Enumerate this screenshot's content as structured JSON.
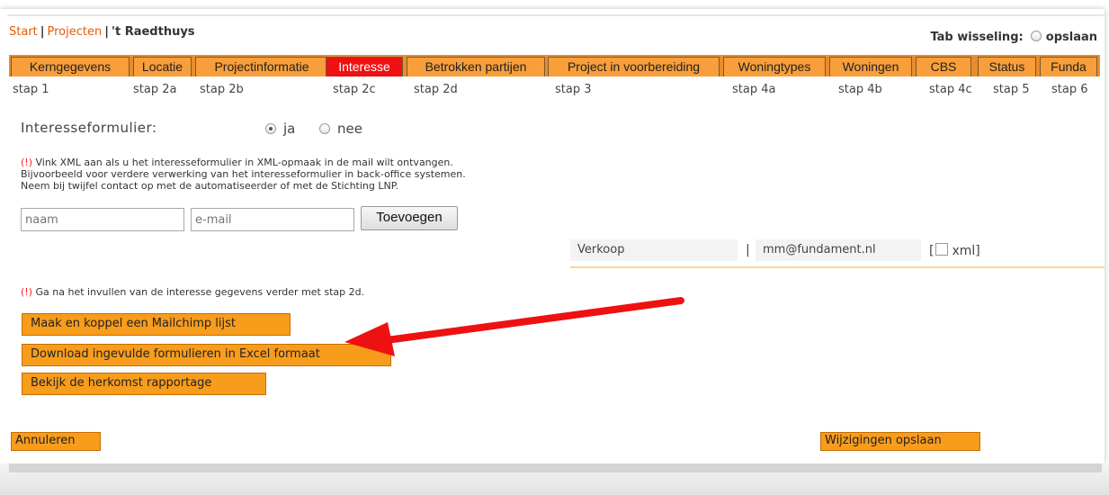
{
  "breadcrumb": {
    "start": "Start",
    "projecten": "Projecten",
    "separator": "|",
    "current": "'t Raedthuys"
  },
  "tab_switch": {
    "label": "Tab wisseling:",
    "option": "opslaan"
  },
  "tabs": [
    {
      "label": "Kerngegevens",
      "step": "stap 1"
    },
    {
      "label": "Locatie",
      "step": "stap 2a"
    },
    {
      "label": "Projectinformatie",
      "step": "stap 2b"
    },
    {
      "label": "Interesse",
      "step": "stap 2c",
      "active": true
    },
    {
      "label": "Betrokken partijen",
      "step": "stap 2d"
    },
    {
      "label": "Project in voorbereiding",
      "step": "stap 3"
    },
    {
      "label": "Woningtypes",
      "step": "stap 4a"
    },
    {
      "label": "Woningen",
      "step": "stap 4b"
    },
    {
      "label": "CBS",
      "step": "stap 4c"
    },
    {
      "label": "Status",
      "step": "stap 5"
    },
    {
      "label": "Funda",
      "step": "stap 6"
    }
  ],
  "interest_form": {
    "label": "Interesseformulier:",
    "options": [
      "ja",
      "nee"
    ],
    "selected": "ja"
  },
  "xml_note": {
    "marker": "(!)",
    "lines": [
      "Vink XML aan als u het interesseformulier in XML-opmaak in de mail wilt ontvangen.",
      "Bijvoorbeeld voor verdere verwerking van het interesseformulier in back-office systemen.",
      "Neem bij twijfel contact op met de automatiseerder of met de Stichting LNP."
    ]
  },
  "add_form": {
    "name_placeholder": "naam",
    "email_placeholder": "e-mail",
    "add_button": "Toevoegen"
  },
  "recipients": [
    {
      "name": "Verkoop",
      "separator": "|",
      "email": "mm@fundament.nl",
      "xml_label": "xml",
      "xml_checked": false
    }
  ],
  "step_note": {
    "marker": "(!)",
    "text": "Ga na het invullen van de interesse gegevens verder met stap 2d."
  },
  "actions": {
    "mailchimp": "Maak en koppel een Mailchimp lijst",
    "download": "Download ingevulde formulieren in Excel formaat",
    "origin": "Bekijk de herkomst rapportage"
  },
  "footer": {
    "cancel": "Annuleren",
    "save": "Wijzigingen opslaan"
  },
  "colors": {
    "tab_bg": "#f89e3a",
    "tab_active": "#ee1111",
    "button_orange": "#f89c1c",
    "link_orange": "#e55a0a",
    "annotation_arrow": "#ee1111"
  }
}
